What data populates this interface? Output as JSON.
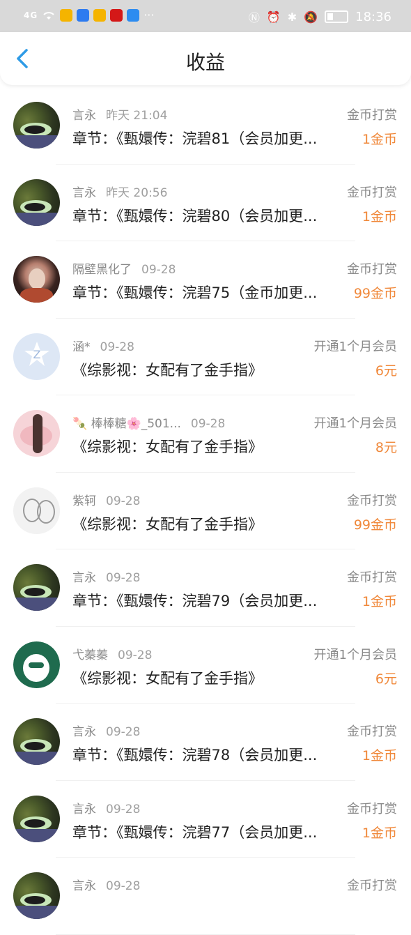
{
  "status_bar": {
    "signal_text": "4G",
    "time": "18:36",
    "more": "···"
  },
  "header": {
    "title": "收益"
  },
  "items": [
    {
      "user": "言永",
      "date": "昨天 21:04",
      "type": "金币打赏",
      "content": "章节：《甄嬛传：浣碧81（会员加更...",
      "amount": "1金币",
      "avatar": "cat"
    },
    {
      "user": "言永",
      "date": "昨天 20:56",
      "type": "金币打赏",
      "content": "章节：《甄嬛传：浣碧80（会员加更...",
      "amount": "1金币",
      "avatar": "cat"
    },
    {
      "user": "隔壁黑化了",
      "date": "09-28",
      "type": "金币打赏",
      "content": "章节：《甄嬛传：浣碧75（金币加更...",
      "amount": "99金币",
      "avatar": "girl"
    },
    {
      "user": "涵*",
      "date": "09-28",
      "type": "开通1个月会员",
      "content": "《综影视：女配有了金手指》",
      "amount": "6元",
      "avatar": "z"
    },
    {
      "user": "🍡 棒棒糖🌸_501...",
      "date": "09-28",
      "type": "开通1个月会员",
      "content": "《综影视：女配有了金手指》",
      "amount": "8元",
      "avatar": "hair"
    },
    {
      "user": "紫轲",
      "date": "09-28",
      "type": "金币打赏",
      "content": "《综影视：女配有了金手指》",
      "amount": "99金币",
      "avatar": "sketch"
    },
    {
      "user": "言永",
      "date": "09-28",
      "type": "金币打赏",
      "content": "章节：《甄嬛传：浣碧79（会员加更...",
      "amount": "1金币",
      "avatar": "cat"
    },
    {
      "user": "弋蓁蓁",
      "date": "09-28",
      "type": "开通1个月会员",
      "content": "《综影视：女配有了金手指》",
      "amount": "6元",
      "avatar": "star"
    },
    {
      "user": "言永",
      "date": "09-28",
      "type": "金币打赏",
      "content": "章节：《甄嬛传：浣碧78（会员加更...",
      "amount": "1金币",
      "avatar": "cat"
    },
    {
      "user": "言永",
      "date": "09-28",
      "type": "金币打赏",
      "content": "章节：《甄嬛传：浣碧77（会员加更...",
      "amount": "1金币",
      "avatar": "cat"
    },
    {
      "user": "言永",
      "date": "09-28",
      "type": "金币打赏",
      "content": "",
      "amount": "",
      "avatar": "cat"
    }
  ],
  "colors": {
    "accent_amount": "#f0883a",
    "back_arrow": "#2e9be6"
  }
}
